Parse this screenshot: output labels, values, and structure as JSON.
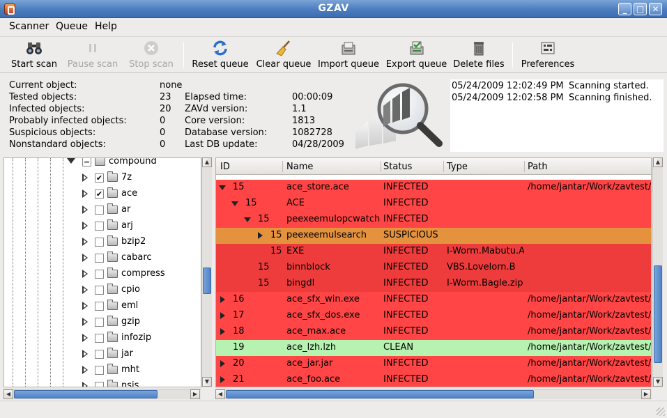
{
  "window": {
    "title": "GZAV",
    "controls": [
      "_",
      "□",
      "✕"
    ]
  },
  "menu": [
    "Scanner",
    "Queue",
    "Help"
  ],
  "toolbar": {
    "start_scan": "Start scan",
    "pause_scan": "Pause scan",
    "stop_scan": "Stop scan",
    "reset_queue": "Reset queue",
    "clear_queue": "Clear queue",
    "import_queue": "Import queue",
    "export_queue": "Export queue",
    "delete_files": "Delete files",
    "preferences": "Preferences"
  },
  "info": {
    "current_object_label": "Current object:",
    "current_object": "none",
    "tested_label": "Tested objects:",
    "tested": "23",
    "infected_label": "Infected objects:",
    "infected": "20",
    "prob_infected_label": "Probably infected objects:",
    "prob_infected": "0",
    "suspicious_label": "Suspicious objects:",
    "suspicious": "0",
    "nonstandard_label": "Nonstandard objects:",
    "nonstandard": "0",
    "elapsed_label": "Elapsed time:",
    "elapsed": "00:00:09",
    "zavd_label": "ZAVd version:",
    "zavd": "1.1",
    "core_label": "Core version:",
    "core": "1813",
    "db_label": "Database version:",
    "db": "1082728",
    "last_update_label": "Last DB update:",
    "last_update": "04/28/2009"
  },
  "log": [
    {
      "time": "05/24/2009 12:02:49 PM",
      "msg": "Scanning started."
    },
    {
      "time": "05/24/2009 12:02:58 PM",
      "msg": "Scanning finished."
    }
  ],
  "tree": {
    "parent": "compound",
    "items": [
      {
        "name": "7z",
        "checked": true
      },
      {
        "name": "ace",
        "checked": true
      },
      {
        "name": "ar",
        "checked": false
      },
      {
        "name": "arj",
        "checked": false
      },
      {
        "name": "bzip2",
        "checked": false
      },
      {
        "name": "cabarc",
        "checked": false
      },
      {
        "name": "compress",
        "checked": false
      },
      {
        "name": "cpio",
        "checked": false
      },
      {
        "name": "eml",
        "checked": false
      },
      {
        "name": "gzip",
        "checked": false
      },
      {
        "name": "infozip",
        "checked": false
      },
      {
        "name": "jar",
        "checked": false
      },
      {
        "name": "mht",
        "checked": false
      },
      {
        "name": "nsis",
        "checked": false
      }
    ]
  },
  "table": {
    "columns": [
      "ID",
      "Name",
      "Status",
      "Type",
      "Path"
    ],
    "rows": [
      {
        "id": "15",
        "name": "ace_store.ace",
        "status": "INFECTED",
        "type": "",
        "path": "/home/jantar/Work/zavtest/c",
        "indent": 0,
        "exp": "down",
        "kind": "infected"
      },
      {
        "id": "15",
        "name": "ACE",
        "status": "INFECTED",
        "type": "",
        "path": "",
        "indent": 1,
        "exp": "down",
        "kind": "infected"
      },
      {
        "id": "15",
        "name": "peexeemulopcwatch",
        "status": "INFECTED",
        "type": "",
        "path": "",
        "indent": 2,
        "exp": "down",
        "kind": "infected"
      },
      {
        "id": "15",
        "name": "peexeemulsearch",
        "status": "SUSPICIOUS",
        "type": "",
        "path": "",
        "indent": 3,
        "exp": "right",
        "kind": "suspicious"
      },
      {
        "id": "15",
        "name": "EXE",
        "status": "INFECTED",
        "type": "I-Worm.Mabutu.A",
        "path": "",
        "indent": 3,
        "exp": "none",
        "kind": "infected-child"
      },
      {
        "id": "15",
        "name": "binnblock",
        "status": "INFECTED",
        "type": "VBS.Lovelorn.B",
        "path": "",
        "indent": 2,
        "exp": "none",
        "kind": "infected-child"
      },
      {
        "id": "15",
        "name": "bingdl",
        "status": "INFECTED",
        "type": "I-Worm.Bagle.zip",
        "path": "",
        "indent": 2,
        "exp": "none",
        "kind": "infected-child"
      },
      {
        "id": "16",
        "name": "ace_sfx_win.exe",
        "status": "INFECTED",
        "type": "",
        "path": "/home/jantar/Work/zavtest/c",
        "indent": 0,
        "exp": "right",
        "kind": "infected"
      },
      {
        "id": "17",
        "name": "ace_sfx_dos.exe",
        "status": "INFECTED",
        "type": "",
        "path": "/home/jantar/Work/zavtest/c",
        "indent": 0,
        "exp": "right",
        "kind": "infected"
      },
      {
        "id": "18",
        "name": "ace_max.ace",
        "status": "INFECTED",
        "type": "",
        "path": "/home/jantar/Work/zavtest/c",
        "indent": 0,
        "exp": "right",
        "kind": "infected"
      },
      {
        "id": "19",
        "name": "ace_lzh.lzh",
        "status": "CLEAN",
        "type": "",
        "path": "/home/jantar/Work/zavtest/c",
        "indent": 0,
        "exp": "none",
        "kind": "clean"
      },
      {
        "id": "20",
        "name": "ace_jar.jar",
        "status": "INFECTED",
        "type": "",
        "path": "/home/jantar/Work/zavtest/c",
        "indent": 0,
        "exp": "right",
        "kind": "infected"
      },
      {
        "id": "21",
        "name": "ace_foo.ace",
        "status": "INFECTED",
        "type": "",
        "path": "/home/jantar/Work/zavtest/c",
        "indent": 0,
        "exp": "right",
        "kind": "infected"
      }
    ]
  },
  "colors": {
    "infected": "#ff4545",
    "infected_child": "#ee3c3c",
    "suspicious": "#e5923e",
    "clean": "#b6f2b0",
    "titlebar": "#4a7cbf",
    "scroll_thumb": "#5b8ccb"
  }
}
